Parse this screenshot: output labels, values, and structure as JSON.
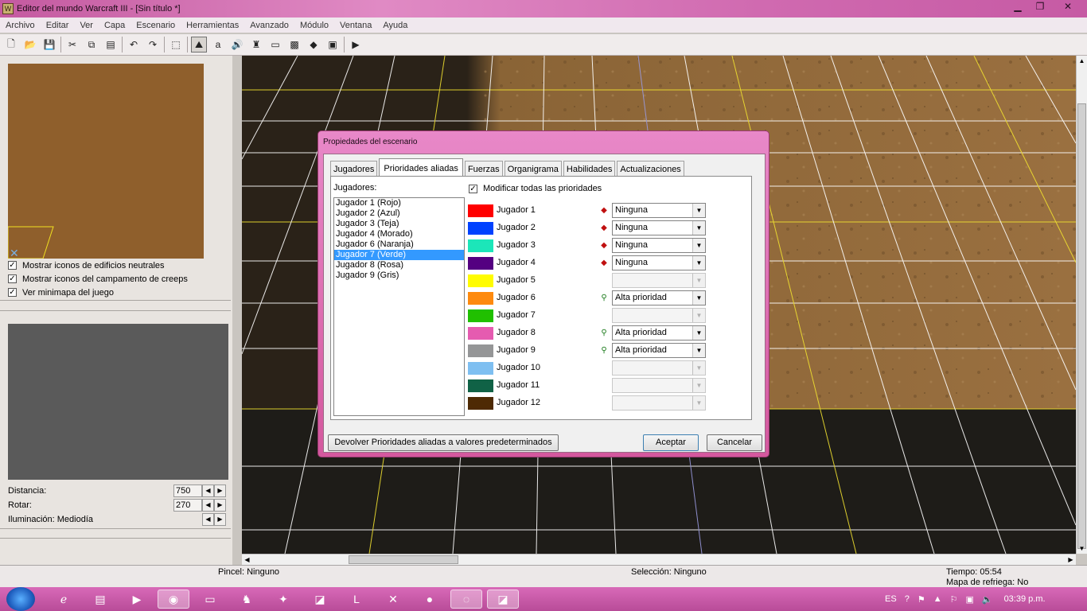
{
  "window": {
    "title": "Editor del mundo Warcraft III  - [Sin título *]"
  },
  "menu": [
    "Archivo",
    "Editar",
    "Ver",
    "Capa",
    "Escenario",
    "Herramientas",
    "Avanzado",
    "Módulo",
    "Ventana",
    "Ayuda"
  ],
  "left": {
    "checkboxes": [
      {
        "label": "Mostrar iconos de edificios neutrales",
        "checked": true
      },
      {
        "label": "Mostrar iconos del campamento de creeps",
        "checked": true
      },
      {
        "label": "Ver minimapa del juego",
        "checked": true
      }
    ],
    "distance_label": "Distancia:",
    "distance_value": "750",
    "rotate_label": "Rotar:",
    "rotate_value": "270",
    "lighting_label": "Iluminación: Mediodía"
  },
  "dialog": {
    "title": "Propiedades del escenario",
    "tabs": [
      "Jugadores",
      "Prioridades aliadas",
      "Fuerzas",
      "Organigrama",
      "Habilidades",
      "Actualizaciones"
    ],
    "selected_tab": "Prioridades aliadas",
    "players_label": "Jugadores:",
    "players_list": [
      "Jugador 1 (Rojo)",
      "Jugador 2 (Azul)",
      "Jugador 3 (Teja)",
      "Jugador 4 (Morado)",
      "Jugador 6 (Naranja)",
      "Jugador 7 (Verde)",
      "Jugador 8 (Rosa)",
      "Jugador 9 (Gris)"
    ],
    "selected_player": "Jugador 7 (Verde)",
    "modify_all": {
      "label": "Modificar todas las prioridades",
      "checked": true
    },
    "priorities": [
      {
        "name": "Jugador 1",
        "color": "#ff0000",
        "icon": "red-diamond-icon",
        "value": "Ninguna",
        "enabled": true
      },
      {
        "name": "Jugador 2",
        "color": "#0042ff",
        "icon": "red-diamond-icon",
        "value": "Ninguna",
        "enabled": true
      },
      {
        "name": "Jugador 3",
        "color": "#1ce6b9",
        "icon": "red-diamond-icon",
        "value": "Ninguna",
        "enabled": true
      },
      {
        "name": "Jugador 4",
        "color": "#540081",
        "icon": "red-diamond-icon",
        "value": "Ninguna",
        "enabled": true
      },
      {
        "name": "Jugador 5",
        "color": "#fffc00",
        "icon": "",
        "value": "",
        "enabled": false
      },
      {
        "name": "Jugador 6",
        "color": "#fe8a0e",
        "icon": "green-link-icon",
        "value": "Alta prioridad",
        "enabled": true
      },
      {
        "name": "Jugador 7",
        "color": "#20c000",
        "icon": "",
        "value": "",
        "enabled": false
      },
      {
        "name": "Jugador 8",
        "color": "#e55bb0",
        "icon": "green-link-icon",
        "value": "Alta prioridad",
        "enabled": true
      },
      {
        "name": "Jugador 9",
        "color": "#959697",
        "icon": "green-link-icon",
        "value": "Alta prioridad",
        "enabled": true
      },
      {
        "name": "Jugador 10",
        "color": "#7ebff1",
        "icon": "",
        "value": "",
        "enabled": false
      },
      {
        "name": "Jugador 11",
        "color": "#106246",
        "icon": "",
        "value": "",
        "enabled": false
      },
      {
        "name": "Jugador 12",
        "color": "#4e2a04",
        "icon": "",
        "value": "",
        "enabled": false
      }
    ],
    "reset_button": "Devolver Prioridades aliadas a valores predeterminados",
    "ok_button": "Aceptar",
    "cancel_button": "Cancelar"
  },
  "status": {
    "brush": "Pincel: Ninguno",
    "selection": "Selección: Ninguno",
    "time": "Tiempo: 05:54",
    "refresh_map": "Mapa de refriega: No"
  },
  "tray": {
    "language": "ES",
    "clock": "03:39 p.m."
  }
}
